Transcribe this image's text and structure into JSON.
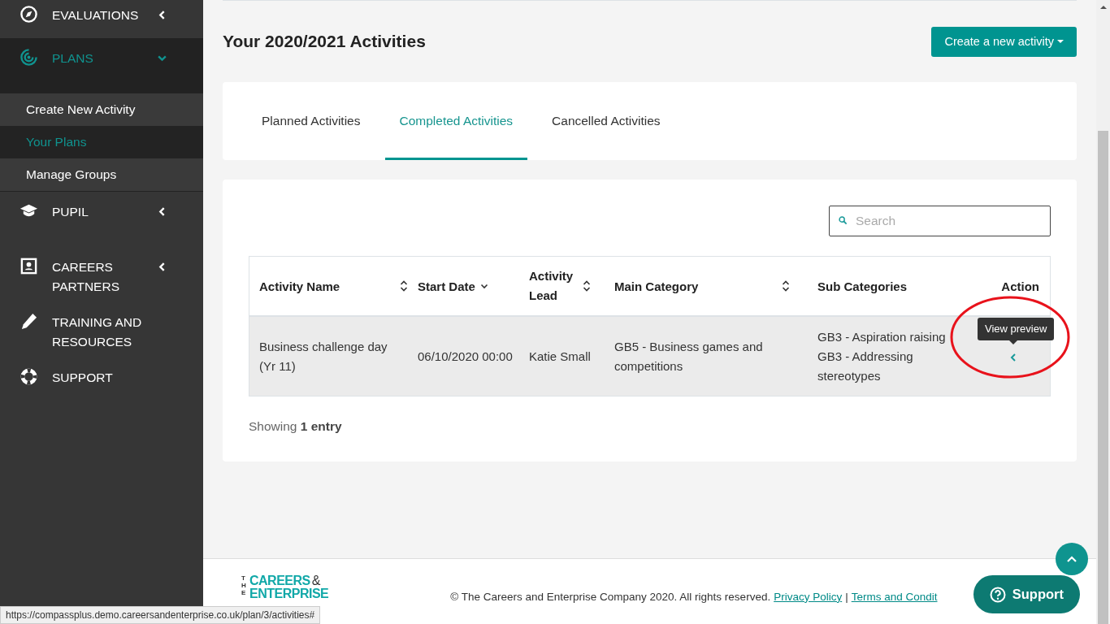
{
  "sidebar": {
    "items": [
      {
        "label": "EVALUATIONS",
        "expanded": false,
        "selected": false
      },
      {
        "label": "PLANS",
        "expanded": true,
        "selected": true,
        "children": [
          {
            "label": "Create New Activity",
            "selected": false
          },
          {
            "label": "Your Plans",
            "selected": true
          },
          {
            "label": "Manage Groups",
            "selected": false
          }
        ]
      },
      {
        "label": "PUPIL",
        "expanded": false,
        "selected": false
      },
      {
        "label": "CAREERS PARTNERS",
        "expanded": false,
        "selected": false
      },
      {
        "label": "TRAINING AND RESOURCES",
        "selected": false
      },
      {
        "label": "SUPPORT",
        "selected": false
      }
    ]
  },
  "page": {
    "title": "Your 2020/2021 Activities",
    "create_button": "Create a new activity"
  },
  "tabs": [
    {
      "label": "Planned Activities",
      "selected": false
    },
    {
      "label": "Completed Activities",
      "selected": true
    },
    {
      "label": "Cancelled Activities",
      "selected": false
    }
  ],
  "search": {
    "placeholder": "Search"
  },
  "table": {
    "columns": [
      {
        "label": "Activity Name",
        "kind": "sortable"
      },
      {
        "label": "Start Date",
        "kind": "sorted"
      },
      {
        "label": "Activity Lead",
        "kind": "sortable"
      },
      {
        "label": "Main Category",
        "kind": "sortable"
      },
      {
        "label": "Sub Categories",
        "kind": "plain"
      },
      {
        "label": "Action",
        "kind": "plain"
      }
    ],
    "rows": [
      {
        "activity_name": "Business challenge day (Yr 11)",
        "start_date": "06/10/2020 00:00",
        "activity_lead": "Katie Small",
        "main_category": "GB5 - Business games and competitions",
        "sub_categories": [
          "GB3 - Aspiration raising",
          "GB3 - Addressing stereotypes"
        ],
        "action_tooltip": "View preview"
      }
    ],
    "showing": "Showing **1 entry**"
  },
  "footer": {
    "logo": {
      "small": "THE",
      "line_1": "CAREERS",
      "amp": "&",
      "line_2": "ENTERPRISE"
    },
    "copyright": "© The Careers and Enterprise Company 2020. All rights reserved.",
    "links": [
      "Privacy Policy",
      "Terms and Condit"
    ],
    "separator": "|"
  },
  "support_button": "Support",
  "status_url": "https://compassplus.demo.careersandenterprise.co.uk/plan/3/activities#"
}
